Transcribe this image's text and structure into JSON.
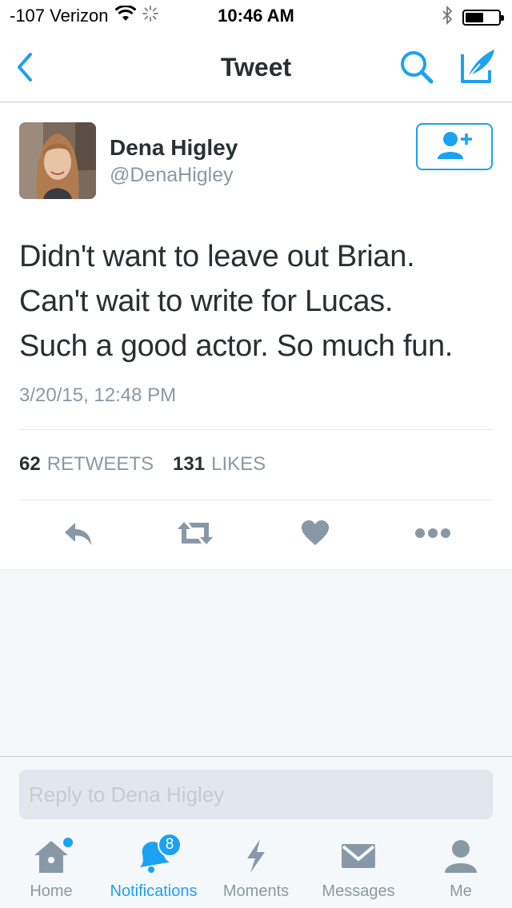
{
  "status_bar": {
    "carrier": "-107 Verizon",
    "time": "10:46 AM",
    "icons": [
      "wifi-icon",
      "activity-spinner-icon",
      "bluetooth-icon",
      "battery-icon"
    ]
  },
  "nav": {
    "title": "Tweet",
    "icons": [
      "back-chevron-icon",
      "search-icon",
      "compose-icon"
    ]
  },
  "tweet": {
    "author_name": "Dena Higley",
    "author_handle": "@DenaHigley",
    "text": "Didn't want to leave out Brian.\nCan't wait to write for Lucas.\nSuch a good actor.  So much fun.",
    "timestamp": "3/20/15, 12:48 PM",
    "retweets_count": "62",
    "retweets_label": "RETWEETS",
    "likes_count": "131",
    "likes_label": "LIKES",
    "actions": [
      "reply-icon",
      "retweet-icon",
      "like-icon",
      "more-icon"
    ]
  },
  "reply": {
    "placeholder": "Reply to Dena Higley"
  },
  "tabs": [
    {
      "label": "Home",
      "icon": "home-icon",
      "active": false,
      "dot": true
    },
    {
      "label": "Notifications",
      "icon": "bell-icon",
      "active": true,
      "badge": "8"
    },
    {
      "label": "Moments",
      "icon": "lightning-icon",
      "active": false
    },
    {
      "label": "Messages",
      "icon": "envelope-icon",
      "active": false
    },
    {
      "label": "Me",
      "icon": "person-icon",
      "active": false
    }
  ],
  "colors": {
    "accent": "#1da1f2",
    "icon_gray": "#8899a6",
    "text": "#292f33",
    "background": "#f5f8fa"
  }
}
